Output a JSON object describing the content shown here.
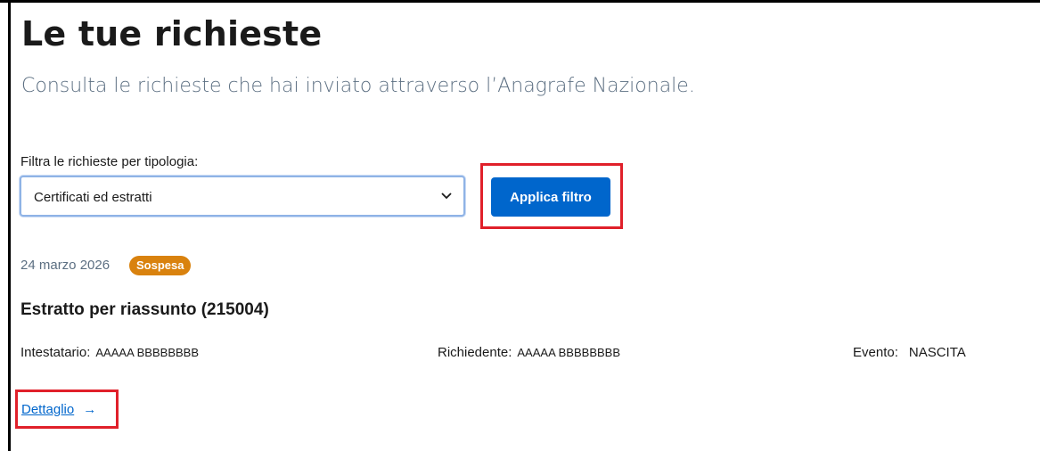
{
  "header": {
    "title": "Le tue richieste",
    "subtitle": "Consulta le richieste che hai inviato attraverso l’Anagrafe Nazionale."
  },
  "filter": {
    "label": "Filtra le richieste per tipologia:",
    "selected": "Certificati ed estratti",
    "apply_label": "Applica filtro"
  },
  "request": {
    "date": "24 marzo 2026",
    "status": "Sospesa",
    "title": "Estratto per riassunto (215004)",
    "fields": {
      "intestatario_label": "Intestatario:",
      "intestatario_value": "AAAAA BBBBBBBB",
      "richiedente_label": "Richiedente:",
      "richiedente_value": "AAAAA BBBBBBBB",
      "evento_label": "Evento:",
      "evento_value": "NASCITA"
    },
    "detail_label": "Dettaglio",
    "detail_arrow": "→"
  },
  "colors": {
    "primary": "#0066cc",
    "badge": "#d9820e",
    "highlight": "#e0202a"
  },
  "icons": {
    "select": "chevron-down-icon",
    "detail": "arrow-right-icon"
  }
}
